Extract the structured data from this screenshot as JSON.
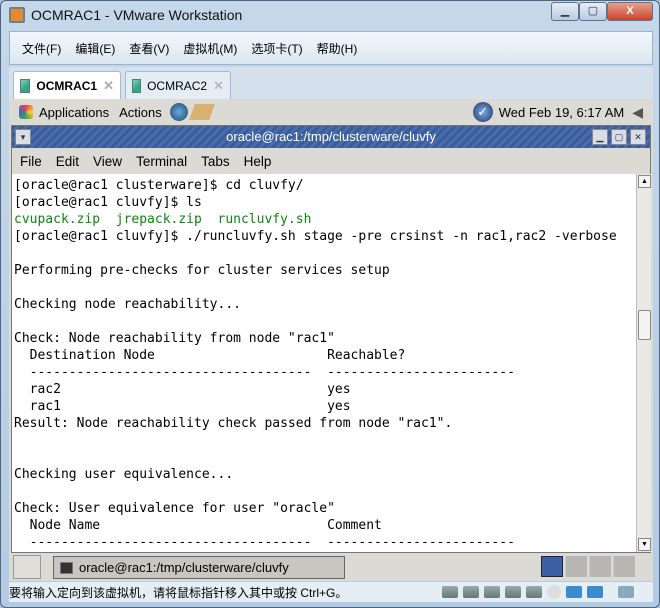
{
  "window": {
    "title": "OCMRAC1 - VMware Workstation"
  },
  "menu": [
    "文件(F)",
    "编辑(E)",
    "查看(V)",
    "虚拟机(M)",
    "选项卡(T)",
    "帮助(H)"
  ],
  "tabs": [
    {
      "label": "OCMRAC1",
      "active": true
    },
    {
      "label": "OCMRAC2",
      "active": false
    }
  ],
  "guest_panel": {
    "applications": "Applications",
    "actions": "Actions",
    "clock": "Wed Feb 19,  6:17 AM"
  },
  "terminal": {
    "title": "oracle@rac1:/tmp/clusterware/cluvfy",
    "menu": [
      "File",
      "Edit",
      "View",
      "Terminal",
      "Tabs",
      "Help"
    ],
    "lines": [
      "[oracle@rac1 clusterware]$ cd cluvfy/",
      "[oracle@rac1 cluvfy]$ ls",
      "",
      "[oracle@rac1 cluvfy]$ ./runcluvfy.sh stage -pre crsinst -n rac1,rac2 -verbose",
      "",
      "Performing pre-checks for cluster services setup",
      "",
      "Checking node reachability...",
      "",
      "Check: Node reachability from node \"rac1\"",
      "  Destination Node                      Reachable?",
      "  ------------------------------------  ------------------------",
      "  rac2                                  yes",
      "  rac1                                  yes",
      "Result: Node reachability check passed from node \"rac1\".",
      "",
      "",
      "Checking user equivalence...",
      "",
      "Check: User equivalence for user \"oracle\"",
      "  Node Name                             Comment",
      "  ------------------------------------  ------------------------"
    ],
    "ls_output": "cvupack.zip  jrepack.zip  runcluvfy.sh"
  },
  "taskbar": {
    "item": "oracle@rac1:/tmp/clusterware/cluvfy"
  },
  "status": {
    "text": "要将输入定向到该虚拟机，请将鼠标指针移入其中或按 Ctrl+G。"
  }
}
